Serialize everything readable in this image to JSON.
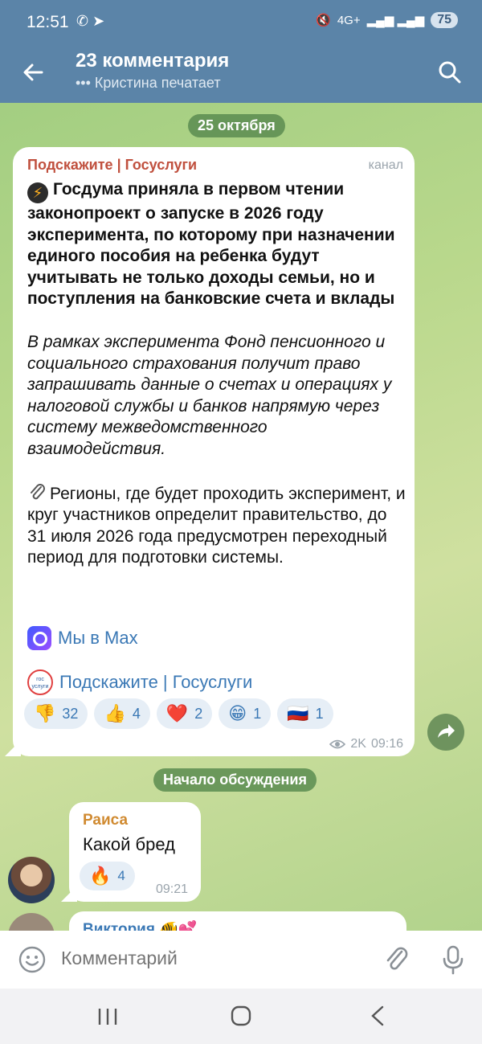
{
  "status_bar": {
    "time": "12:51",
    "left_icons": "✆ ➤",
    "network": "4G+",
    "battery": "75"
  },
  "header": {
    "title": "23 комментария",
    "subtitle": "••• Кристина печатает"
  },
  "date_label": "25 октября",
  "post": {
    "author": "Подскажите | Госуслуги",
    "tag": "канал",
    "headline": "Госдума приняла в первом чтении законопроект о запуске в 2026 году эксперимента, по которому при назначении единого пособия на ребенка будут учитывать не только доходы семьи, но и поступления на банковские счета и вклады",
    "italic_paragraph": "В рамках эксперимента Фонд пенсионного и социального страхования получит право запрашивать данные о счетах и операциях у налоговой службы и банков напрямую через систему межведомственного взаимодействия.",
    "paragraph3": "Регионы, где будет проходить эксперимент, и круг участников определит правительство, до 31 июля 2026 года предусмотрен переходный период для подготовки системы.",
    "link1": "Мы в Max",
    "link2": "Подскажите | Госуслуги",
    "gos_icon_text": "гос услуги",
    "reactions": [
      {
        "emoji": "👎",
        "count": "32"
      },
      {
        "emoji": "👍",
        "count": "4"
      },
      {
        "emoji": "❤️",
        "count": "2"
      },
      {
        "emoji": "😁",
        "count": "1"
      },
      {
        "emoji": "🇷🇺",
        "count": "1"
      }
    ],
    "views": "2K",
    "time": "09:16"
  },
  "discussion_label": "Начало обсуждения",
  "comment": {
    "author": "Раиса",
    "text": "Какой бред",
    "reaction_emoji": "🔥",
    "reaction_count": "4",
    "time": "09:21"
  },
  "comment2": {
    "author": "Виктория 🐠💕"
  },
  "input": {
    "placeholder": "Комментарий"
  }
}
